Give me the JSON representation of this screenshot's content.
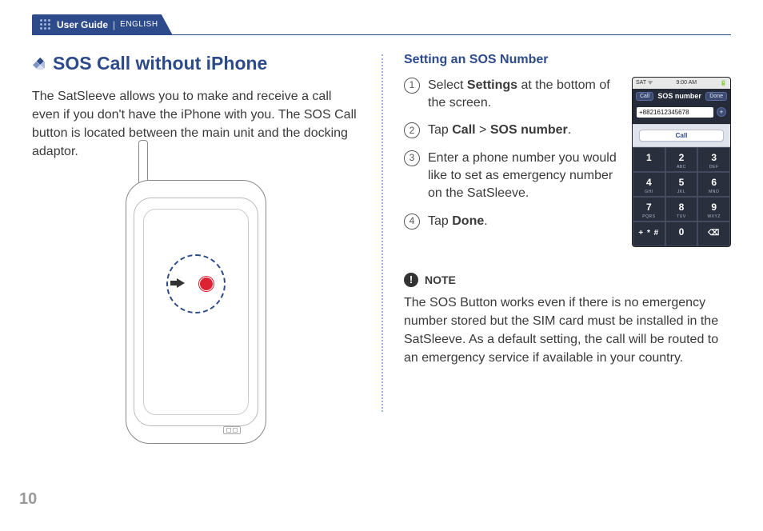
{
  "header": {
    "user_guide": "User Guide",
    "separator": "|",
    "language": "ENGLISH"
  },
  "page_number": "10",
  "left": {
    "title": "SOS Call without iPhone",
    "paragraph": "The SatSleeve allows you to make and receive a call even if you don't have the iPhone with you. The SOS Call button is located between the main unit and the docking adaptor."
  },
  "right": {
    "subhead": "Setting an SOS Number",
    "steps": [
      {
        "n": "1",
        "pre": "Select ",
        "b1": "Settings",
        "post": " at the bottom of the screen."
      },
      {
        "n": "2",
        "pre": "Tap ",
        "b1": "Call",
        "mid": " > ",
        "b2": "SOS number",
        "post": "."
      },
      {
        "n": "3",
        "pre": "Enter a phone number you would like to set as emergency number on the SatSleeve.",
        "b1": "",
        "post": ""
      },
      {
        "n": "4",
        "pre": "Tap ",
        "b1": "Done",
        "post": "."
      }
    ],
    "note_label": "NOTE",
    "note_text": "The SOS Button works even if there is no emergency number stored but the SIM card must be installed in the SatSleeve. As a default setting, the call will be routed to an emergency service if available in your country."
  },
  "phone": {
    "status_left": "SAT ᯤ",
    "status_time": "9:00 AM",
    "status_right": "🔋",
    "btn_left": "Call",
    "title": "SOS number",
    "btn_right": "Done",
    "input_value": "+8821612345678",
    "call_label": "Call",
    "keys": [
      {
        "d": "1",
        "s": ""
      },
      {
        "d": "2",
        "s": "ABC"
      },
      {
        "d": "3",
        "s": "DEF"
      },
      {
        "d": "4",
        "s": "GHI"
      },
      {
        "d": "5",
        "s": "JKL"
      },
      {
        "d": "6",
        "s": "MNO"
      },
      {
        "d": "7",
        "s": "PQRS"
      },
      {
        "d": "8",
        "s": "TUV"
      },
      {
        "d": "9",
        "s": "WXYZ"
      },
      {
        "d": "+ * #",
        "s": ""
      },
      {
        "d": "0",
        "s": ""
      },
      {
        "d": "⌫",
        "s": ""
      }
    ]
  }
}
